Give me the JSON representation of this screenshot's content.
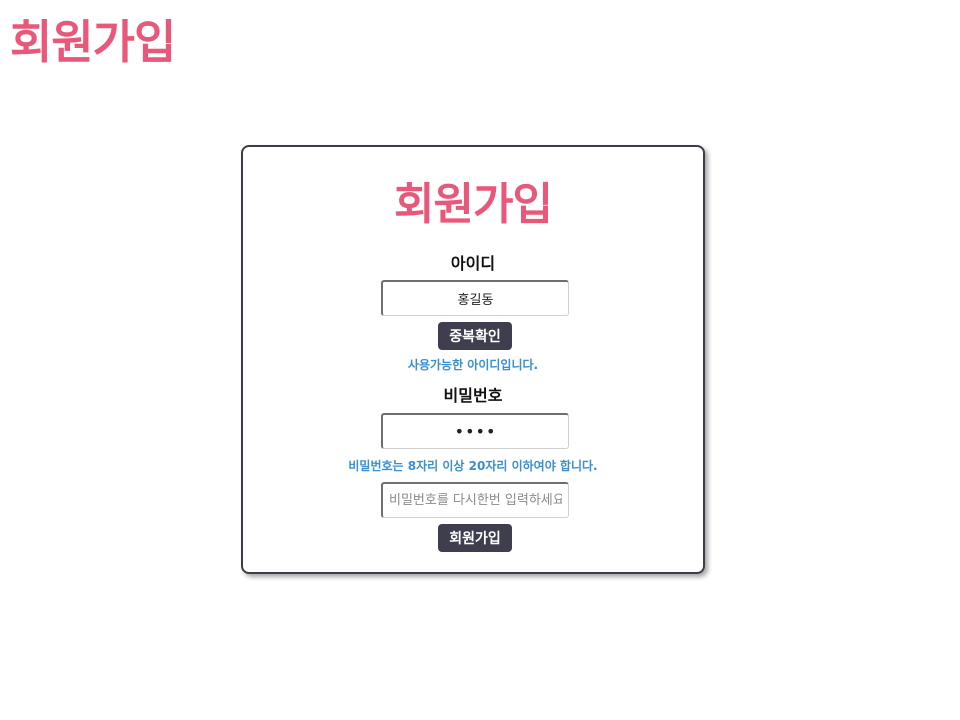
{
  "header": {
    "title": "회원가입"
  },
  "form": {
    "title": "회원가입",
    "id_label": "아이디",
    "id_value": "홍길동",
    "check_button_label": "중복확인",
    "id_status_message": "사용가능한 아이디입니다.",
    "password_label": "비밀번호",
    "password_value": "1234",
    "password_rule_message": "비밀번호는 8자리 이상 20자리 이하여야 합니다.",
    "password_confirm_placeholder": "비밀번호를 다시한번 입력하세요",
    "password_confirm_value": "",
    "submit_button_label": "회원가입"
  },
  "colors": {
    "brand_pink": "#e8587a",
    "button_dark": "#3e3e4e",
    "info_blue": "#3a8fd0",
    "card_border": "#3d3d4a"
  }
}
